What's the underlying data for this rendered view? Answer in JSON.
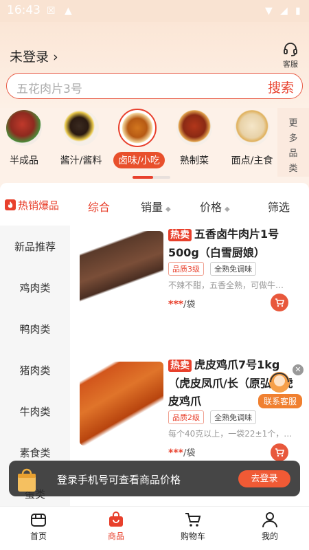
{
  "status": {
    "time": "16:43"
  },
  "header": {
    "login_text": "未登录 ›",
    "service_label": "客服"
  },
  "search": {
    "placeholder": "五花肉片3号",
    "button": "搜索"
  },
  "categories": [
    {
      "name": "半成品"
    },
    {
      "name": "酱汁/酱料"
    },
    {
      "name": "卤味/小吃"
    },
    {
      "name": "熟制菜"
    },
    {
      "name": "面点/主食"
    }
  ],
  "more_label": "更多品类",
  "hot_category": "热销爆品",
  "sort": {
    "comprehensive": "综合",
    "sales": "销量",
    "price": "价格",
    "filter": "筛选"
  },
  "sidebar": [
    "新品推荐",
    "鸡肉类",
    "鸭肉类",
    "猪肉类",
    "牛肉类",
    "素食类",
    "蛋类"
  ],
  "products": [
    {
      "badge": "热卖",
      "title": "五香卤牛肉片1号500g（白雪厨娘）",
      "tags": [
        "品质3级",
        "全熟免调味"
      ],
      "desc": "不辣不甜，五香全熟，可做牛…",
      "price": "***",
      "unit": "/袋"
    },
    {
      "badge": "热卖",
      "title": "虎皮鸡爪7号1kg（虎皮凤爪/长（原弘润虎皮鸡爪",
      "tags": [
        "品质2级",
        "全熟免调味"
      ],
      "desc": "每个40克以上，一袋22±1个，…",
      "price": "***",
      "unit": "/袋"
    }
  ],
  "float_service": "联系客服",
  "banner": {
    "text": "登录手机号可查看商品价格",
    "button": "去登录"
  },
  "tabs": [
    {
      "label": "首页"
    },
    {
      "label": "商品"
    },
    {
      "label": "购物车"
    },
    {
      "label": "我的"
    }
  ],
  "colors": {
    "accent": "#e8402c",
    "background": "#fdf1e8"
  }
}
